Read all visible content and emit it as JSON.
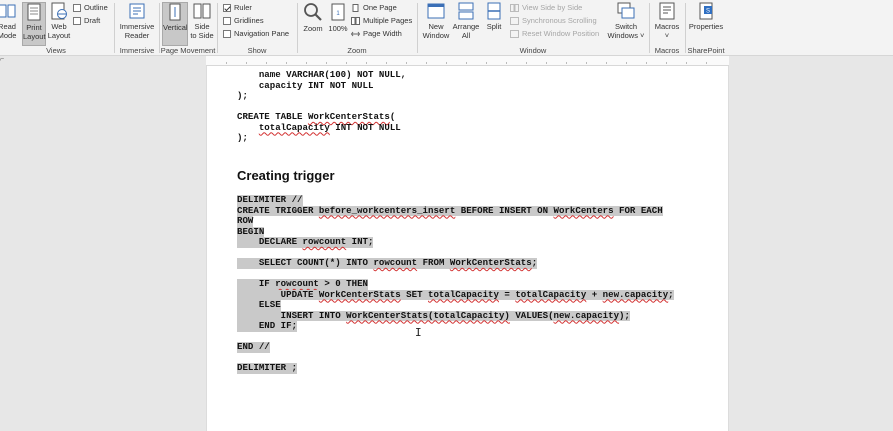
{
  "ribbon": {
    "views": {
      "label": "Views",
      "read_mode": [
        "Read",
        "Mode"
      ],
      "print_layout": [
        "Print",
        "Layout"
      ],
      "web_layout": [
        "Web",
        "Layout"
      ],
      "outline": "Outline",
      "draft": "Draft"
    },
    "immersive": {
      "label": "Immersive",
      "reader": [
        "Immersive",
        "Reader"
      ]
    },
    "page_movement": {
      "label": "Page Movement",
      "vertical": "Vertical",
      "side_to_side": [
        "Side",
        "to Side"
      ]
    },
    "show": {
      "label": "Show",
      "ruler": "Ruler",
      "ruler_checked": true,
      "gridlines": "Gridlines",
      "navigation_pane": "Navigation Pane"
    },
    "zoom": {
      "label": "Zoom",
      "zoom": "Zoom",
      "percent": "100%",
      "one_page": "One Page",
      "multiple_pages": "Multiple Pages",
      "page_width": "Page Width"
    },
    "window": {
      "label": "Window",
      "new_window": [
        "New",
        "Window"
      ],
      "arrange_all": [
        "Arrange",
        "All"
      ],
      "split": "Split",
      "view_side_by_side": "View Side by Side",
      "synchronous_scrolling": "Synchronous Scrolling",
      "reset_window_position": "Reset Window Position",
      "switch_windows": [
        "Switch",
        "Windows ˅"
      ]
    },
    "macros": {
      "label": "Macros",
      "macros": "Macros"
    },
    "sharepoint": {
      "label": "SharePoint",
      "properties": "Properties"
    }
  },
  "document": {
    "lines_top": [
      "    name VARCHAR(100) NOT NULL,",
      "    capacity INT NOT NULL",
      ");",
      "",
      "CREATE TABLE WorkCenterStats(",
      "    totalCapacity INT NOT NULL",
      ");"
    ],
    "heading": "Creating trigger",
    "trigger": {
      "l1": "DELIMITER //",
      "l2_a": "CREATE TRIGGER ",
      "l2_b": "before_workcenters_insert",
      "l2_c": " BEFORE INSERT ON ",
      "l2_d": "WorkCenters",
      "l2_e": " FOR EACH",
      "l3": "ROW",
      "l4": "BEGIN",
      "l5_a": "    DECLARE ",
      "l5_b": "rowcount",
      "l5_c": " INT;",
      "l6_a": "    SELECT COUNT(*) INTO ",
      "l6_b": "rowcount",
      "l6_c": " FROM ",
      "l6_d": "WorkCenterStats",
      "l6_e": ";",
      "l7_a": "    IF ",
      "l7_b": "rowcount",
      "l7_c": " > 0 THEN",
      "l8_a": "        UPDATE ",
      "l8_b": "WorkCenterStats",
      "l8_c": " SET ",
      "l8_d": "totalCapacity",
      "l8_e": " = ",
      "l8_f": "totalCapacity",
      "l8_g": " + ",
      "l8_h": "new.capacity",
      "l8_i": ";",
      "l9": "    ELSE",
      "l10_a": "        INSERT INTO ",
      "l10_b": "WorkCenterStats(totalCapacity)",
      "l10_c": " VALUES(",
      "l10_d": "new.capacity",
      "l10_e": ");",
      "l11": "    END IF;",
      "l12": "END //",
      "l13": "DELIMITER ;"
    }
  }
}
